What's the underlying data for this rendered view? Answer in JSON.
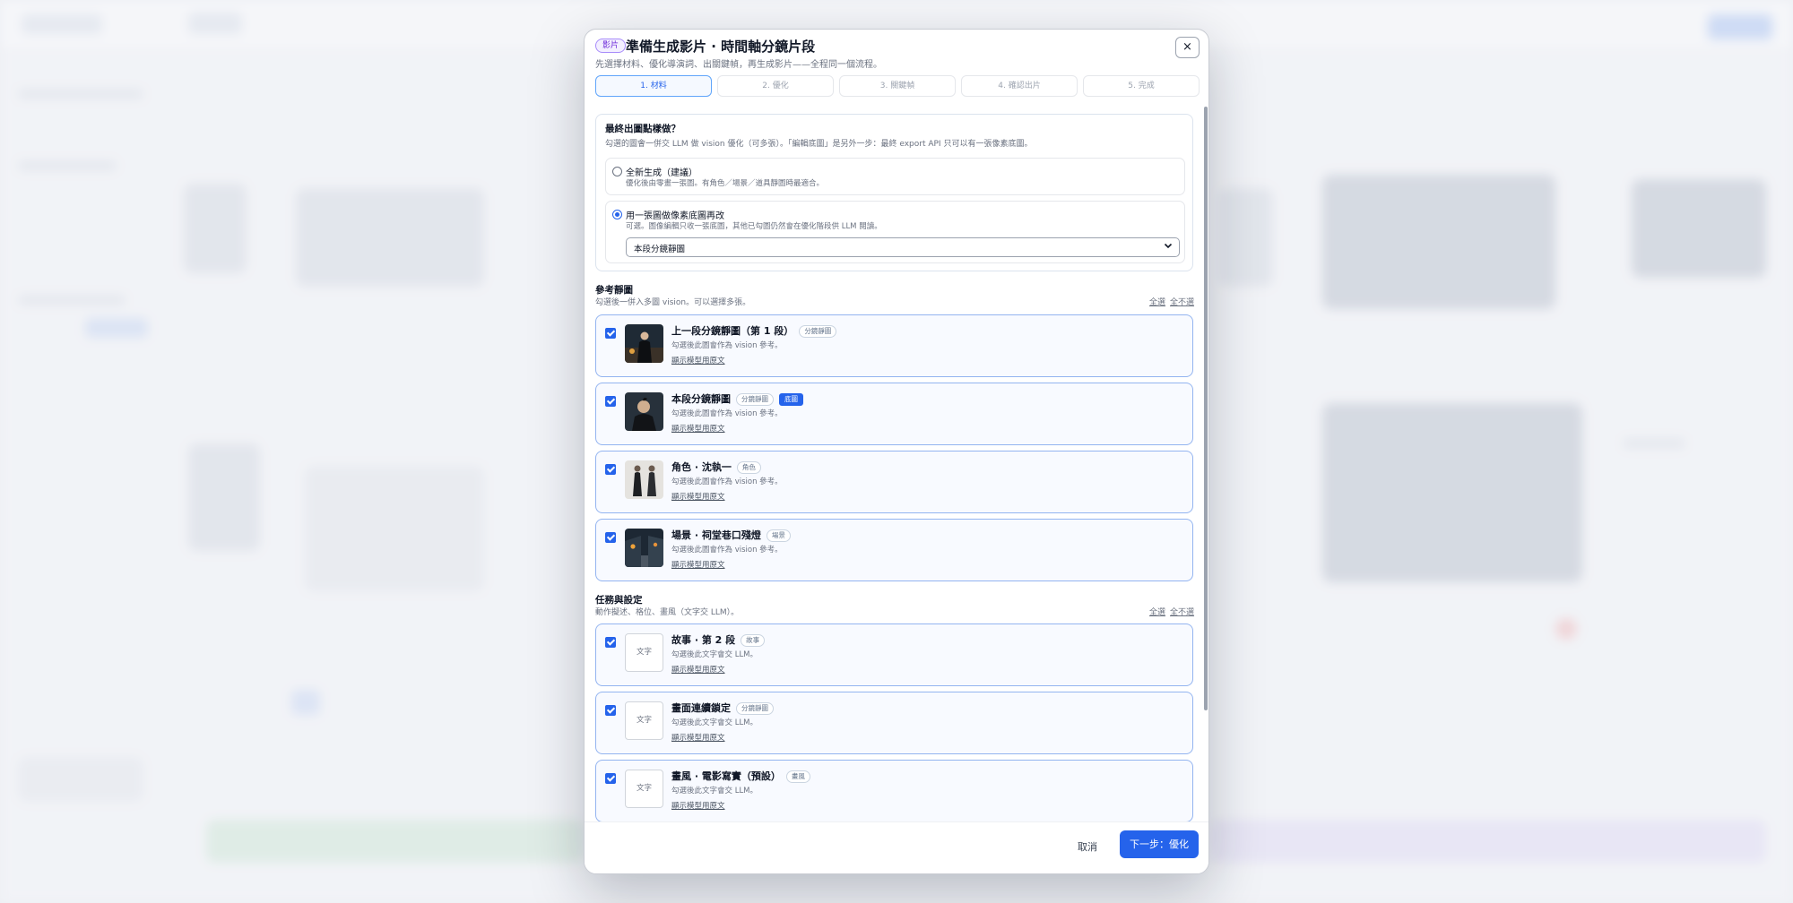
{
  "modal": {
    "tag": "影片",
    "title": "準備生成影片 · 時間軸分鏡片段",
    "subtitle": "先選擇材料、優化導演詞、出關鍵幀，再生成影片——全程同一個流程。",
    "close_label": "×",
    "steps": [
      "1. 材料",
      "2. 優化",
      "3. 關鍵幀",
      "4. 確認出片",
      "5. 完成"
    ],
    "active_step": 0
  },
  "final_output": {
    "title": "最終出圖點樣做？",
    "description": "勾選的圖會一併交 LLM 做 vision 優化（可多張）。「編輯底圖」是另外一步：最終 export API 只可以有一張像素底圖。",
    "options": [
      {
        "label": "全新生成（建議）",
        "description": "優化後由零畫一張圖。有角色／場景／道具靜圖時最適合。",
        "selected": false
      },
      {
        "label": "用一張圖做像素底圖再改",
        "description": "可選。圖像編輯只收一張底圖，其他已勾圖仍然會在優化階段供 LLM 閱讀。",
        "selected": true
      }
    ],
    "select_value": "本段分鏡靜圖"
  },
  "reference_images": {
    "title": "參考靜圖",
    "description": "勾選後一併入多圖 vision。可以選擇多張。",
    "select_all": "全選",
    "select_none": "全不選",
    "items": [
      {
        "title": "上一段分鏡靜圖（第 1 段）",
        "badges": [
          "分鏡靜圖"
        ],
        "base_badge": "",
        "description": "勾選後此圖會作為 vision 參考。",
        "link": "顯示模型用原文",
        "thumb": "thumb-prev-shot",
        "checked": true
      },
      {
        "title": "本段分鏡靜圖",
        "badges": [
          "分鏡靜圖"
        ],
        "base_badge": "底圖",
        "description": "勾選後此圖會作為 vision 參考。",
        "link": "顯示模型用原文",
        "thumb": "thumb-current-shot",
        "checked": true
      },
      {
        "title": "角色 · 沈執一",
        "badges": [
          "角色"
        ],
        "base_badge": "",
        "description": "勾選後此圖會作為 vision 參考。",
        "link": "顯示模型用原文",
        "thumb": "thumb-character",
        "checked": true
      },
      {
        "title": "場景 · 祠堂巷口殘燈",
        "badges": [
          "場景"
        ],
        "base_badge": "",
        "description": "勾選後此圖會作為 vision 參考。",
        "link": "顯示模型用原文",
        "thumb": "thumb-scene",
        "checked": true
      }
    ]
  },
  "tasks": {
    "title": "任務與設定",
    "description": "動作擬述、格位、畫風（文字交 LLM）。",
    "select_all": "全選",
    "select_none": "全不選",
    "items": [
      {
        "title": "故事 · 第 2 段",
        "badges": [
          "故事"
        ],
        "description": "勾選後此文字會交 LLM。",
        "link": "顯示模型用原文",
        "thumb_text": "文字",
        "checked": true
      },
      {
        "title": "畫面連續鎖定",
        "badges": [
          "分鏡靜圖"
        ],
        "description": "勾選後此文字會交 LLM。",
        "link": "顯示模型用原文",
        "thumb_text": "文字",
        "checked": true
      },
      {
        "title": "畫風 · 電影寫實（預設）",
        "badges": [
          "畫風"
        ],
        "description": "勾選後此文字會交 LLM。",
        "link": "顯示模型用原文",
        "thumb_text": "文字",
        "checked": true
      }
    ]
  },
  "footer": {
    "cancel": "取消",
    "next": "下一步：優化"
  },
  "colors": {
    "accent": "#2563eb",
    "card_border": "#93b4f0",
    "tag_purple": "#6d28d9"
  }
}
